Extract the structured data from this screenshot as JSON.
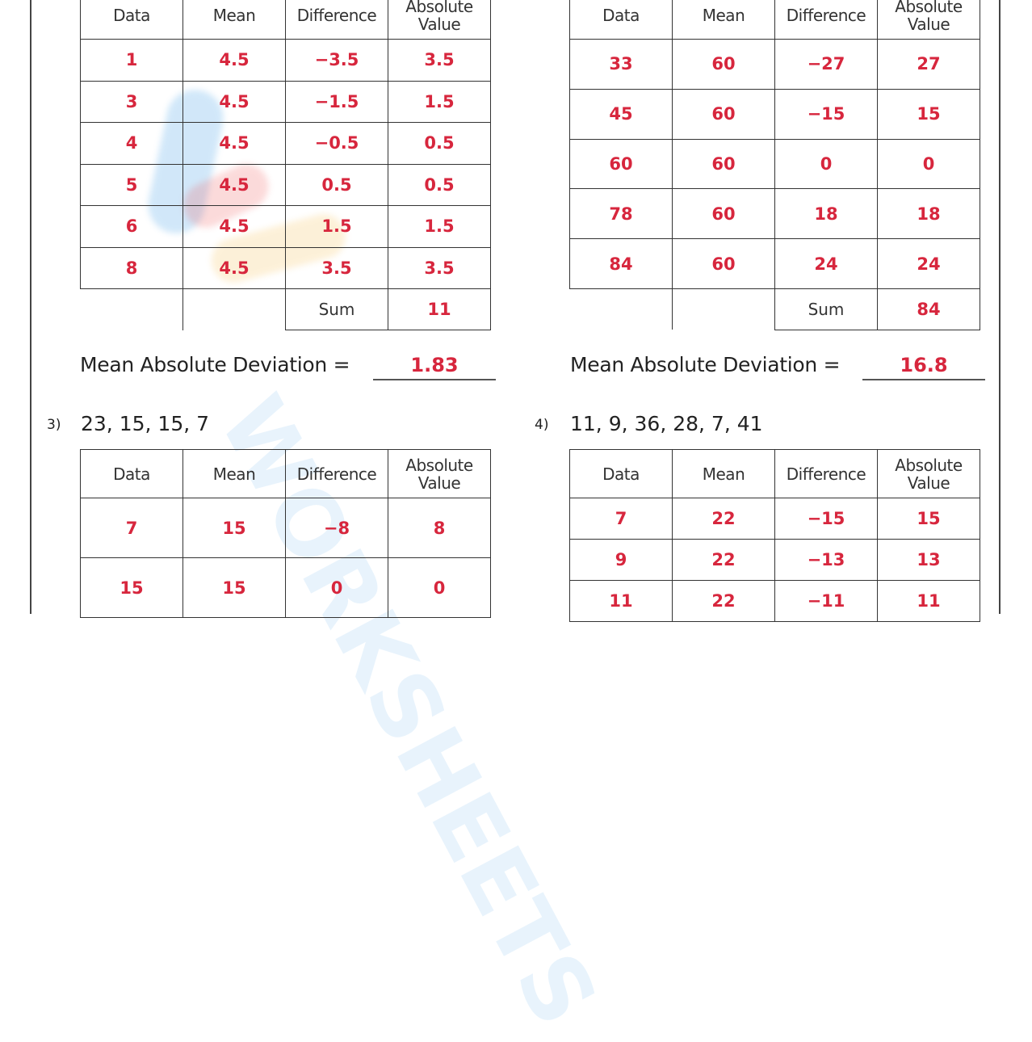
{
  "watermark": "WORKSHEETS",
  "colors": {
    "answer": "#d7263d",
    "text": "#222222",
    "border": "#333333"
  },
  "headers": [
    "Data",
    "Mean",
    "Difference",
    "Absolute Value"
  ],
  "sum_label": "Sum",
  "mad_label": "Mean Absolute Deviation  =",
  "problems": [
    {
      "number": "",
      "list": "",
      "rows": [
        [
          "1",
          "4.5",
          "−3.5",
          "3.5"
        ],
        [
          "3",
          "4.5",
          "−1.5",
          "1.5"
        ],
        [
          "4",
          "4.5",
          "−0.5",
          "0.5"
        ],
        [
          "5",
          "4.5",
          "0.5",
          "0.5"
        ],
        [
          "6",
          "4.5",
          "1.5",
          "1.5"
        ],
        [
          "8",
          "4.5",
          "3.5",
          "3.5"
        ]
      ],
      "sum": "11",
      "mad": "1.83"
    },
    {
      "number": "",
      "list": "",
      "rows": [
        [
          "33",
          "60",
          "−27",
          "27"
        ],
        [
          "45",
          "60",
          "−15",
          "15"
        ],
        [
          "60",
          "60",
          "0",
          "0"
        ],
        [
          "78",
          "60",
          "18",
          "18"
        ],
        [
          "84",
          "60",
          "24",
          "24"
        ]
      ],
      "sum": "84",
      "mad": "16.8"
    },
    {
      "number": "3)",
      "list": "23,  15,  15,  7",
      "rows": [
        [
          "7",
          "15",
          "−8",
          "8"
        ],
        [
          "15",
          "15",
          "0",
          "0"
        ]
      ]
    },
    {
      "number": "4)",
      "list": "11,  9,  36,  28,  7,  41",
      "rows": [
        [
          "7",
          "22",
          "−15",
          "15"
        ],
        [
          "9",
          "22",
          "−13",
          "13"
        ],
        [
          "11",
          "22",
          "−11",
          "11"
        ]
      ]
    }
  ]
}
